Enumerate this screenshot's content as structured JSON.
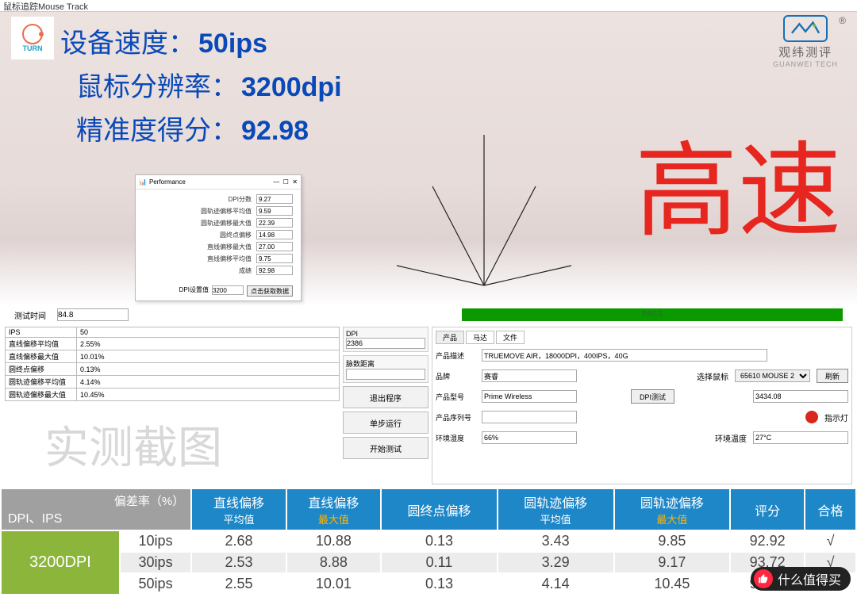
{
  "window_title": "鼠标追踪Mouse Track",
  "hero": {
    "speed_label": "设备速度：",
    "speed_value": "50ips",
    "dpi_label": "鼠标分辨率：",
    "dpi_value": "3200dpi",
    "score_label": "精准度得分：",
    "score_value": "92.98",
    "big_text": "高速",
    "turn_text": "TURN",
    "gw_cn": "观纬测评",
    "gw_en": "GUANWEI TECH"
  },
  "perf": {
    "title": "Performance",
    "rows": [
      {
        "label": "DPI分数",
        "value": "9.27"
      },
      {
        "label": "圆轨迹偏移平均值",
        "value": "9.59"
      },
      {
        "label": "圆轨迹偏移最大值",
        "value": "22.39"
      },
      {
        "label": "圆终点偏移",
        "value": "14.98"
      },
      {
        "label": "直线偏移最大值",
        "value": "27.00"
      },
      {
        "label": "直线偏移平均值",
        "value": "9.75"
      },
      {
        "label": "成绩",
        "value": "92.98"
      }
    ],
    "foot_label": "DPI设置值",
    "foot_value": "3200",
    "foot_button": "点击获取数据"
  },
  "mid": {
    "time_label": "测试时间",
    "time_value": "84.8",
    "pass_text": "PASS"
  },
  "left_table": {
    "head_l": "IPS",
    "head_r": "50",
    "rows": [
      {
        "k": "直线偏移平均值",
        "v": "2.55%"
      },
      {
        "k": "直线偏移最大值",
        "v": "10.01%"
      },
      {
        "k": "圆终点偏移",
        "v": "0.13%"
      },
      {
        "k": "圆轨迹偏移平均值",
        "v": "4.14%"
      },
      {
        "k": "圆轨迹偏移最大值",
        "v": "10.45%"
      }
    ],
    "watermark": "实测截图"
  },
  "mid_col": {
    "dpi_label": "DPI",
    "dpi_value": "2386",
    "sens_label": "脉数距离",
    "sens_value": "",
    "btn_exit": "退出程序",
    "btn_step": "单步运行",
    "btn_start": "开始测试"
  },
  "right": {
    "tabs": [
      "产品",
      "马达",
      "文件"
    ],
    "desc_label": "产品描述",
    "desc_value": "TRUEMOVE AIR，18000DPI，400IPS，40G",
    "brand_label": "品牌",
    "brand_value": "赛睿",
    "mouse_label": "选择鼠标",
    "mouse_value": "65610  MOUSE  2",
    "refresh": "刷新",
    "model_label": "产品型号",
    "model_value": "Prime Wireless",
    "dpi_test": "DPI测试",
    "right_num": "3434.08",
    "serial_label": "产品序列号",
    "serial_value": "",
    "indicator": "指示灯",
    "humid_label": "环境湿度",
    "humid_value": "66%",
    "temp_label": "环境温度",
    "temp_value": "27°C"
  },
  "summary": {
    "corner_top": "偏差率（%）",
    "corner_bottom": "DPI、IPS",
    "headers": [
      {
        "t1": "直线偏移",
        "t2": "平均值",
        "max": false
      },
      {
        "t1": "直线偏移",
        "t2": "最大值",
        "max": true
      },
      {
        "t1": "圆终点偏移",
        "t2": "",
        "max": false
      },
      {
        "t1": "圆轨迹偏移",
        "t2": "平均值",
        "max": false
      },
      {
        "t1": "圆轨迹偏移",
        "t2": "最大值",
        "max": true
      },
      {
        "t1": "评分",
        "t2": "",
        "max": false
      },
      {
        "t1": "合格",
        "t2": "",
        "max": false
      }
    ],
    "dpi": "3200DPI",
    "rows": [
      {
        "ips": "10ips",
        "v": [
          "2.68",
          "10.88",
          "0.13",
          "3.43",
          "9.85",
          "92.92",
          "√"
        ]
      },
      {
        "ips": "30ips",
        "v": [
          "2.53",
          "8.88",
          "0.11",
          "3.29",
          "9.17",
          "93.72",
          "√"
        ]
      },
      {
        "ips": "50ips",
        "v": [
          "2.55",
          "10.01",
          "0.13",
          "4.14",
          "10.45",
          "92.98",
          ""
        ]
      }
    ]
  },
  "badge": "什么值得买"
}
